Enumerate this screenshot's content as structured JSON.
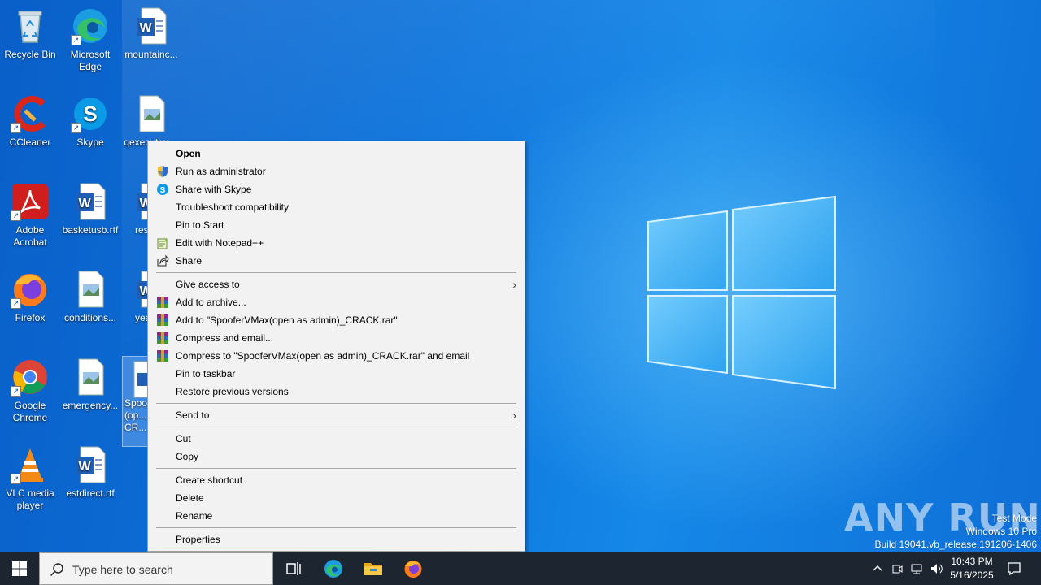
{
  "desktop": {
    "icons": [
      {
        "label": "Recycle Bin",
        "icon": "recycle-bin-icon"
      },
      {
        "label": "Microsoft Edge",
        "icon": "edge-icon"
      },
      {
        "label": "mountainc...",
        "icon": "word-doc-icon"
      },
      {
        "label": "CCleaner",
        "icon": "ccleaner-icon"
      },
      {
        "label": "Skype",
        "icon": "skype-icon"
      },
      {
        "label": "qexecutive...",
        "icon": "image-file-icon"
      },
      {
        "label": "Adobe Acrobat",
        "icon": "acrobat-icon"
      },
      {
        "label": "basketusb.rtf",
        "icon": "word-doc-icon"
      },
      {
        "label": "resou...",
        "icon": "word-doc-icon"
      },
      {
        "label": "Firefox",
        "icon": "firefox-icon"
      },
      {
        "label": "conditions...",
        "icon": "image-file-icon"
      },
      {
        "label": "yearn...",
        "icon": "word-doc-icon"
      },
      {
        "label": "Google Chrome",
        "icon": "chrome-icon"
      },
      {
        "label": "emergency...",
        "icon": "image-file-icon"
      },
      {
        "label": "Spoof... (op... admi... CR...",
        "icon": "selected-file-icon"
      },
      {
        "label": "VLC media player",
        "icon": "vlc-icon"
      },
      {
        "label": "estdirect.rtf",
        "icon": "word-doc-icon"
      }
    ]
  },
  "context_menu": {
    "group1": [
      {
        "label": "Open",
        "icon": "",
        "bold": true
      },
      {
        "label": "Run as administrator",
        "icon": "uac-shield-icon"
      },
      {
        "label": "Share with Skype",
        "icon": "skype-icon"
      },
      {
        "label": "Troubleshoot compatibility",
        "icon": ""
      },
      {
        "label": "Pin to Start",
        "icon": ""
      },
      {
        "label": "Edit with Notepad++",
        "icon": "notepadpp-icon"
      },
      {
        "label": "Share",
        "icon": "share-icon"
      }
    ],
    "group2": [
      {
        "label": "Give access to",
        "icon": "",
        "submenu": true
      },
      {
        "label": "Add to archive...",
        "icon": "winrar-icon"
      },
      {
        "label": "Add to \"SpooferVMax(open as admin)_CRACK.rar\"",
        "icon": "winrar-icon"
      },
      {
        "label": "Compress and email...",
        "icon": "winrar-icon"
      },
      {
        "label": "Compress to \"SpooferVMax(open as admin)_CRACK.rar\" and email",
        "icon": "winrar-icon"
      },
      {
        "label": "Pin to taskbar",
        "icon": ""
      },
      {
        "label": "Restore previous versions",
        "icon": ""
      }
    ],
    "group3": [
      {
        "label": "Send to",
        "icon": "",
        "submenu": true
      }
    ],
    "group4": [
      {
        "label": "Cut",
        "icon": ""
      },
      {
        "label": "Copy",
        "icon": ""
      }
    ],
    "group5": [
      {
        "label": "Create shortcut",
        "icon": ""
      },
      {
        "label": "Delete",
        "icon": ""
      },
      {
        "label": "Rename",
        "icon": ""
      }
    ],
    "group6": [
      {
        "label": "Properties",
        "icon": ""
      }
    ]
  },
  "taskbar": {
    "search_placeholder": "Type here to search",
    "apps": [
      "task-view-icon",
      "edge-icon",
      "file-explorer-icon",
      "firefox-icon"
    ],
    "time": "10:43 PM",
    "date": "5/16/2025"
  },
  "watermark": {
    "brand": "ANY RUN",
    "line1": "Test Mode",
    "line2": "Windows 10 Pro",
    "line3": "Build 19041.vb_release.191206-1406"
  },
  "colors": {
    "wallpaper": "#0a6fd4",
    "taskbar": "#1c2530",
    "menu_bg": "#f2f2f2"
  }
}
